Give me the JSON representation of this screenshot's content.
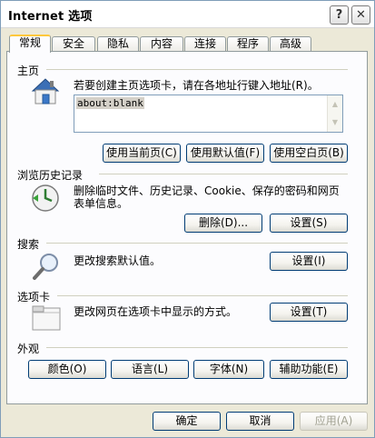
{
  "window": {
    "title": "Internet 选项",
    "help_label": "?",
    "close_label": "✕"
  },
  "tabs": [
    {
      "label": "常规",
      "active": true
    },
    {
      "label": "安全"
    },
    {
      "label": "隐私"
    },
    {
      "label": "内容"
    },
    {
      "label": "连接"
    },
    {
      "label": "程序"
    },
    {
      "label": "高级"
    }
  ],
  "home": {
    "title": "主页",
    "description": "若要创建主页选项卡，请在各地址行键入地址(R)。",
    "address_value": "about:blank",
    "buttons": [
      "使用当前页(C)",
      "使用默认值(F)",
      "使用空白页(B)"
    ]
  },
  "history": {
    "title": "浏览历史记录",
    "description_line1": "删除临时文件、历史记录、Cookie、保存的密码和网页",
    "description_line2": "表单信息。",
    "delete_label": "删除(D)...",
    "settings_label": "设置(S)"
  },
  "search": {
    "title": "搜索",
    "description": "更改搜索默认值。",
    "settings_label": "设置(I)"
  },
  "tabsection": {
    "title": "选项卡",
    "description": "更改网页在选项卡中显示的方式。",
    "settings_label": "设置(T)"
  },
  "appearance": {
    "title": "外观",
    "buttons": [
      "颜色(O)",
      "语言(L)",
      "字体(N)",
      "辅助功能(E)"
    ]
  },
  "footer": {
    "ok_label": "确定",
    "cancel_label": "取消",
    "apply_label": "应用(A)"
  }
}
